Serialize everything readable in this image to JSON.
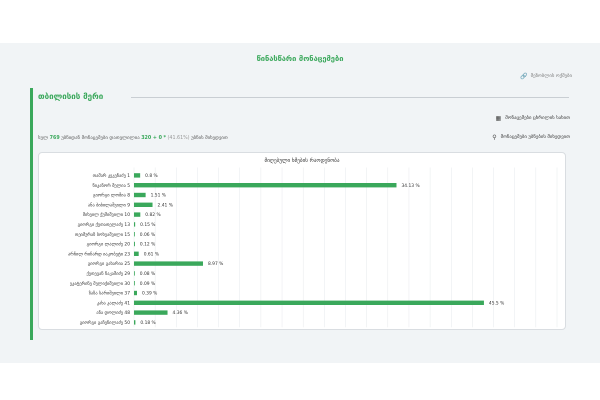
{
  "header": {
    "title": "წინასწარი მონაცემები",
    "print_label": "მეზობლის ოქმები"
  },
  "section": {
    "title": "თბილისის მერი"
  },
  "links": {
    "protocols": "მონაცემები ცხრილის სახით",
    "precincts": "მონაცემები უბნების მიხედვით"
  },
  "summary": {
    "prefix": "სულ",
    "total": "769",
    "mid": "უბნიდან მონაცემები დათვლილია",
    "counted": "320 + 0",
    "star": "*",
    "percent": "(41.61%)",
    "suffix": "უბნის მიხედვით"
  },
  "colors": {
    "accent": "#3aa85b",
    "bar": "#3aa85b",
    "grid": "#e6e9ec"
  },
  "chart_data": {
    "type": "bar",
    "orientation": "horizontal",
    "title": "მიღებული ხმების რაოდენობა",
    "categories": [
      "თამარ კეკენაძე 1",
      "ნიკანორ მელია 5",
      "გიორგი ლომია 8",
      "ანა ბიბილაშვილი 9",
      "მიხეილ ქუშიშვილი 10",
      "გიორგი ქუთათელაძე 13",
      "თეიმურაზ ბოხუაშვილი 15",
      "გიორგი ლალიძე 20",
      "არჩილ რიჩარდ იაკობეტი 23",
      "გიორგი გახარია 25",
      "ქეთევან ნაკაშიძე 29",
      "ეკატერინე მელიქიშვილი 30",
      "ზაზა სარიშვილი 37",
      "კახა კალაძე 41",
      "ანა დოლიძე 48",
      "გიორგი გაჩეჩილაძე 50"
    ],
    "values": [
      0.8,
      34.13,
      1.51,
      2.41,
      0.82,
      0.15,
      0.06,
      0.12,
      0.61,
      8.97,
      0.08,
      0.09,
      0.39,
      45.5,
      4.36,
      0.18
    ],
    "value_labels": [
      "0.8 %",
      "34.13 %",
      "1.51 %",
      "2.41 %",
      "0.82 %",
      "0.15 %",
      "0.06 %",
      "0.12 %",
      "0.61 %",
      "8.97 %",
      "0.08 %",
      "0.09 %",
      "0.39 %",
      "45.5 %",
      "4.36 %",
      "0.18 %"
    ],
    "xlim": [
      0,
      55
    ],
    "grid": true,
    "legend": "none"
  }
}
